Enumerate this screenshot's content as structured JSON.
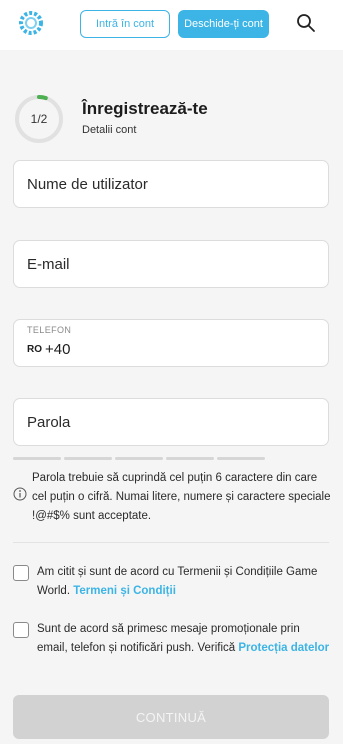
{
  "header": {
    "login_label": "Intră în cont",
    "signup_label": "Deschide-ți cont"
  },
  "steps": {
    "current": "1",
    "separator": "/",
    "total": "2",
    "progress": 0.05
  },
  "form": {
    "title": "Înregistrează-te",
    "subtitle": "Detalii cont",
    "username_placeholder": "Nume de utilizator",
    "email_placeholder": "E-mail",
    "phone_label": "TELEFON",
    "phone_country": "RO",
    "phone_prefix": "+40",
    "password_placeholder": "Parola",
    "password_hint": "Parola trebuie să cuprindă cel puțin 6 caractere din care cel puțin o cifră. Numai litere, numere și caractere speciale !@#$% sunt acceptate."
  },
  "consents": {
    "terms_text": "Am citit și sunt de acord cu Termenii și Condițiile Game World.",
    "terms_link": "Termeni și Condiții",
    "marketing_text": "Sunt de acord să primesc mesaje promoționale prin email, telefon și notificări push. Verifică",
    "privacy_link": "Protecția datelor"
  },
  "actions": {
    "continue_label": "CONTINUĂ"
  },
  "colors": {
    "accent": "#3cb4e5",
    "background": "#f5f5f5",
    "disabled_button": "#d2d2d2"
  }
}
